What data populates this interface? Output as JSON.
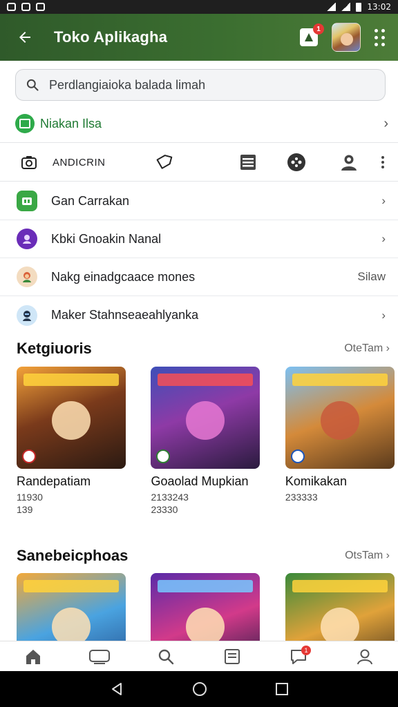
{
  "status_bar": {
    "time": "13:02"
  },
  "app_bar": {
    "title": "Toko Aplikagha",
    "notification_count": "1",
    "accent_color": "#3b6e30"
  },
  "search": {
    "placeholder": "Perdlangiaioka balada limah"
  },
  "promo": {
    "label": "Niakan Ilsa"
  },
  "tabs": {
    "first_label": "ANDICRIN"
  },
  "list": [
    {
      "label": "Gan Carrakan",
      "trailing": ""
    },
    {
      "label": "Kbki Gnoakin Nanal",
      "trailing": ""
    },
    {
      "label": "Nakg einadgcaace mones",
      "trailing": "Silaw"
    },
    {
      "label": "Maker Stahnseaeahlyanka",
      "trailing": ""
    }
  ],
  "section1": {
    "title": "Ketgiuoris",
    "more": "OteTam",
    "cards": [
      {
        "name": "Randepatiam",
        "meta": "11930",
        "meta2": "139"
      },
      {
        "name": "Goaolad Mupkian",
        "meta": "2133243",
        "meta2": "23330"
      },
      {
        "name": "Komikakan",
        "meta": "233333",
        "meta2": ""
      }
    ]
  },
  "section2": {
    "title": "Sanebeicphoas",
    "more": "OtsTam"
  },
  "bottom_nav": {
    "badge": "1"
  }
}
